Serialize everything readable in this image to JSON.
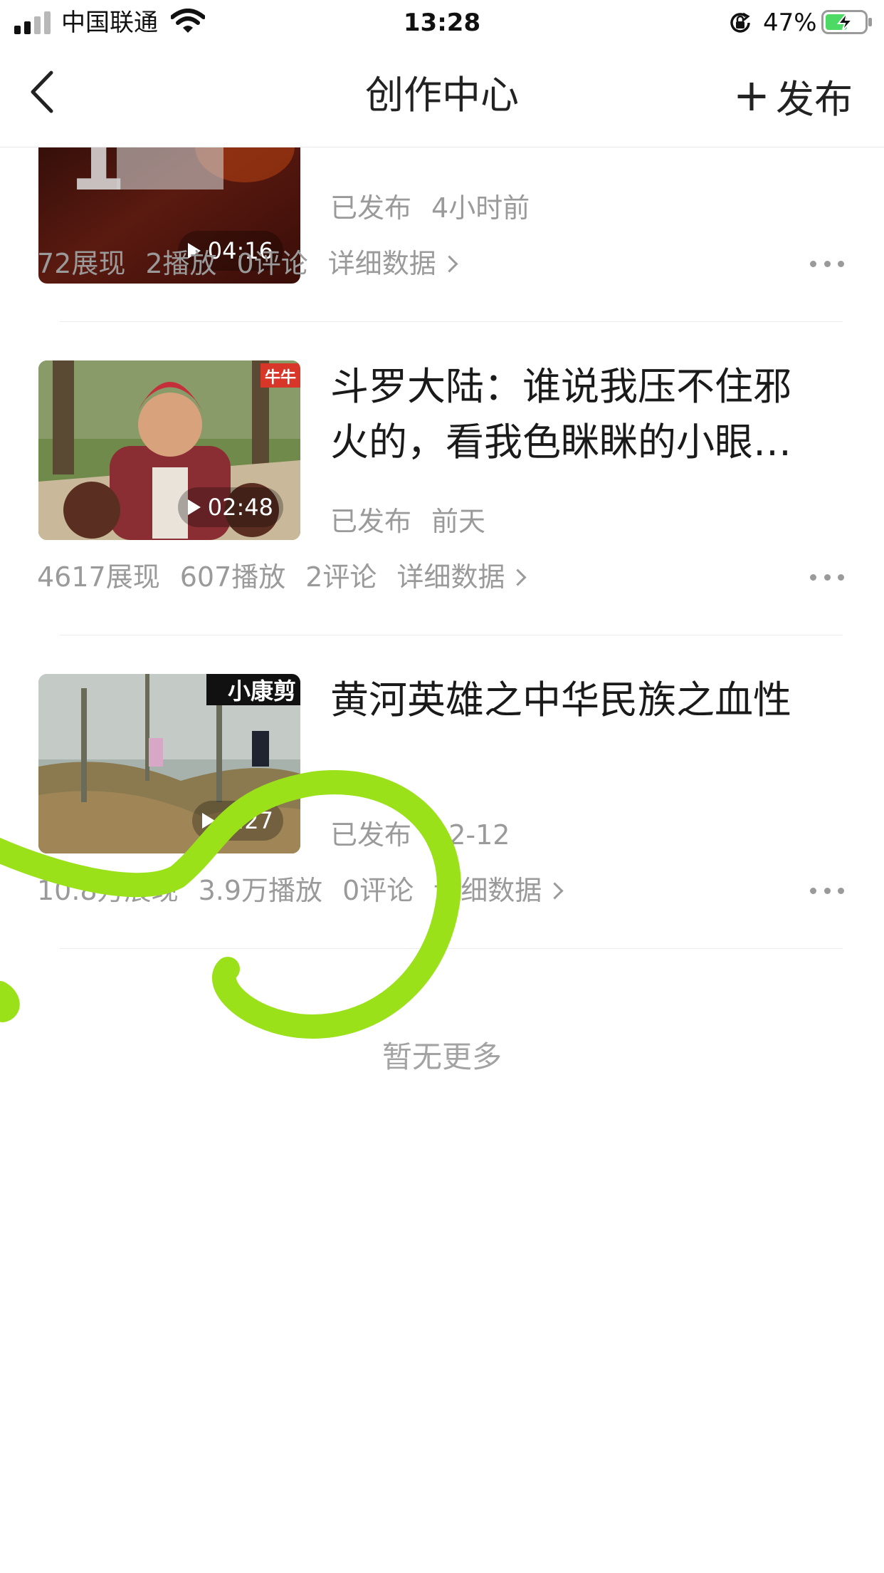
{
  "status_bar": {
    "carrier": "中国联通",
    "time": "13:28",
    "battery_percent": "47%",
    "battery_level": 0.47,
    "icons": [
      "signal-icon",
      "wifi-icon",
      "orientation-lock-icon",
      "battery-charging-icon"
    ]
  },
  "nav": {
    "back_icon": "chevron-left-icon",
    "title": "创作中心",
    "publish_label": "发布",
    "publish_icon": "+"
  },
  "videos": [
    {
      "title": "",
      "duration": "04:16",
      "status": "已发布",
      "time": "4小时前",
      "views": "72展现",
      "plays": "2播放",
      "comments": "0评论",
      "detail": "详细数据"
    },
    {
      "title": "斗罗大陆：谁说我压不住邪火的，看我色眯眯的小眼…",
      "duration": "02:48",
      "status": "已发布",
      "time": "前天",
      "views": "4617展现",
      "plays": "607播放",
      "comments": "2评论",
      "detail": "详细数据",
      "thumb_badge": "牛牛"
    },
    {
      "title": "黄河英雄之中华民族之血性",
      "duration": "5:27",
      "status": "已发布",
      "time": "02-12",
      "views": "10.8万展现",
      "plays": "3.9万播放",
      "comments": "0评论",
      "detail": "详细数据",
      "thumb_badge": "小康剪"
    }
  ],
  "footer": {
    "no_more": "暂无更多"
  },
  "colors": {
    "annotation": "#9be11a",
    "meta_gray": "#9a9a9a"
  }
}
